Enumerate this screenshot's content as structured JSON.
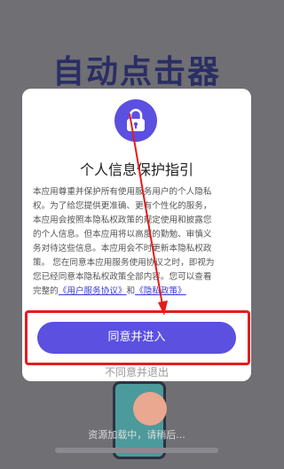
{
  "background": {
    "app_title": "自动点击器",
    "loading_text": "资源加载中，请稍后..."
  },
  "dialog": {
    "icon": "lock-icon",
    "title": "个人信息保护指引",
    "body_lines": [
      "本应用尊重并保护所有使用服务用户的个人隐私",
      "权。为了给您提供更准确、更有个性化的服务，",
      "本应用会按照本隐私权政策的规定使用和披露您",
      "的个人信息。但本应用将以高度的勤勉、审慎义",
      "务对待这些信息。本应用会不时更新本隐私权政",
      "策。 您在同意本应用服务使用协议之时，即视为",
      "您已经同意本隐私权政策全部内容。您可以查看"
    ],
    "last_line_prefix": "完整的",
    "user_agreement_link": "《用户服务协议》",
    "conjunction": "和",
    "privacy_policy_link": "《隐私政策》",
    "agree_button": "同意并进入",
    "disagree_link": "不同意并退出"
  },
  "colors": {
    "accent": "#5b50e0",
    "highlight": "#e51c1c",
    "overlay": "#6f6f74"
  }
}
